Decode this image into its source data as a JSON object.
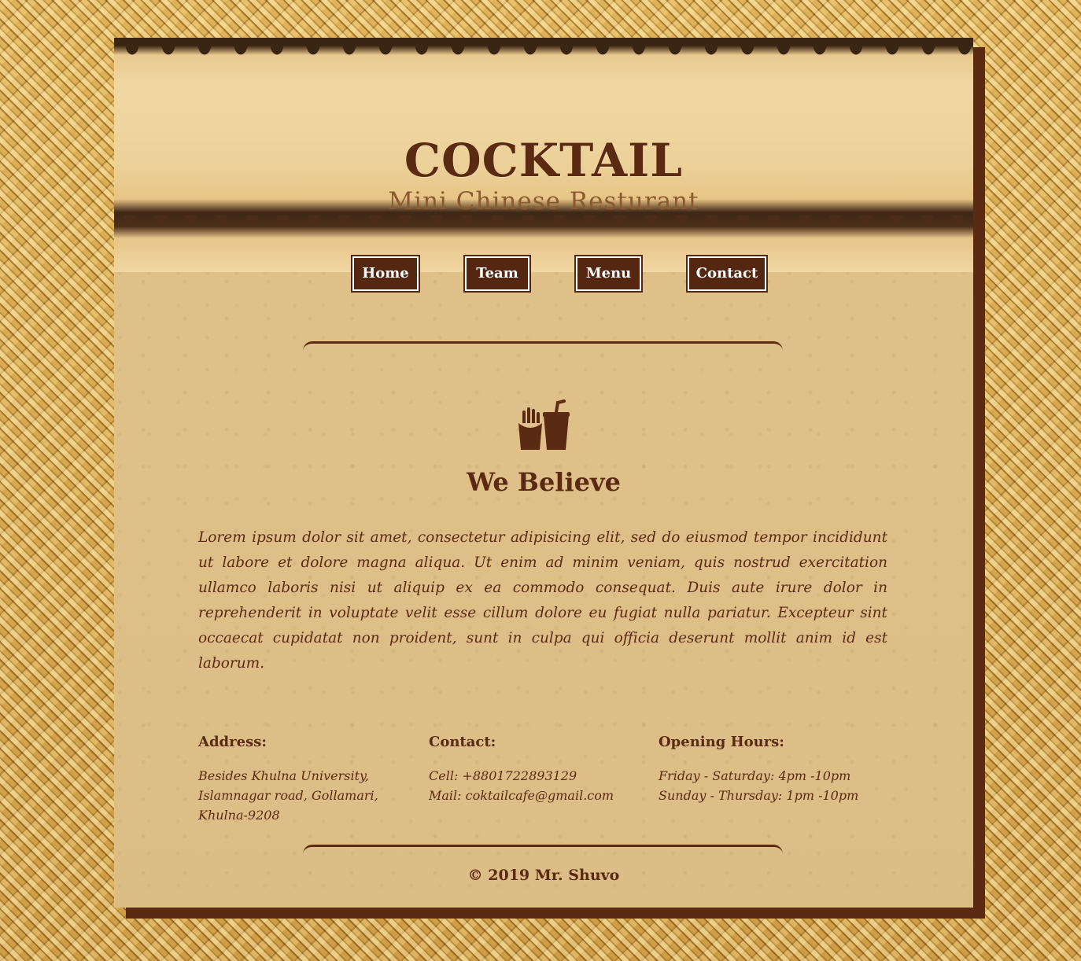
{
  "header": {
    "brand": "COCKTAIL",
    "tagline": "Mini Chinese Resturant"
  },
  "nav": {
    "items": [
      {
        "label": "Home"
      },
      {
        "label": "Team"
      },
      {
        "label": "Menu"
      },
      {
        "label": "Contact"
      }
    ]
  },
  "main": {
    "icon": "fries-and-drink-icon",
    "title": "We Believe",
    "text": "Lorem ipsum dolor sit amet, consectetur adipisicing elit, sed do eiusmod tempor incididunt ut labore et dolore magna aliqua. Ut enim ad minim veniam, quis nostrud exercitation ullamco laboris nisi ut aliquip ex ea commodo consequat. Duis aute irure dolor in reprehenderit in voluptate velit esse cillum dolore eu fugiat nulla pariatur. Excepteur sint occaecat cupidatat non proident, sunt in culpa qui officia deserunt mollit anim id est laborum."
  },
  "info": {
    "address": {
      "heading": "Address:",
      "lines": [
        "Besides Khulna University,",
        "Islamnagar road, Gollamari,",
        "Khulna-9208"
      ]
    },
    "contact": {
      "heading": "Contact:",
      "lines": [
        "Cell: +8801722893129",
        "Mail: coktailcafe@gmail.com"
      ]
    },
    "hours": {
      "heading": "Opening Hours:",
      "lines": [
        "Friday - Saturday: 4pm -10pm",
        "Sunday - Thursday: 1pm -10pm"
      ]
    }
  },
  "footer": {
    "copyright": "© 2019 Mr. Shuvo"
  },
  "colors": {
    "brand_brown": "#5a2a12",
    "paper": "#e2c590",
    "weave": "#c99a3e"
  }
}
